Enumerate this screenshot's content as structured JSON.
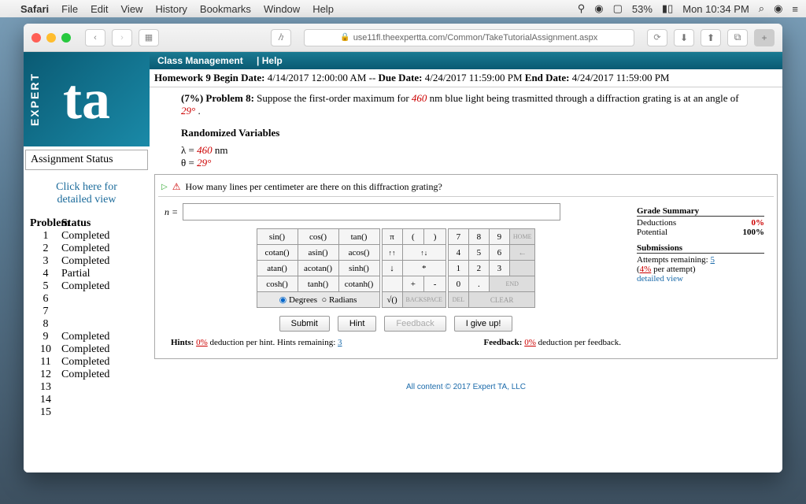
{
  "menubar": {
    "app": "Safari",
    "items": [
      "File",
      "Edit",
      "View",
      "History",
      "Bookmarks",
      "Window",
      "Help"
    ],
    "battery": "53%",
    "clock": "Mon 10:34 PM"
  },
  "browser": {
    "url": "use11fl.theexpertta.com/Common/TakeTutorialAssignment.aspx"
  },
  "logo": {
    "side": "EXPERT",
    "main": "ta"
  },
  "sidebar": {
    "assign_title": "Assignment Status",
    "click1": "Click here for",
    "click2": "detailed view",
    "head_problem": "Problem",
    "head_status": "Status",
    "rows": [
      {
        "n": "1",
        "s": "Completed"
      },
      {
        "n": "2",
        "s": "Completed"
      },
      {
        "n": "3",
        "s": "Completed"
      },
      {
        "n": "4",
        "s": "Partial"
      },
      {
        "n": "5",
        "s": "Completed"
      },
      {
        "n": "6",
        "s": ""
      },
      {
        "n": "7",
        "s": ""
      },
      {
        "n": "8",
        "s": ""
      },
      {
        "n": "9",
        "s": "Completed"
      },
      {
        "n": "10",
        "s": "Completed"
      },
      {
        "n": "11",
        "s": "Completed"
      },
      {
        "n": "12",
        "s": "Completed"
      },
      {
        "n": "13",
        "s": ""
      },
      {
        "n": "14",
        "s": ""
      },
      {
        "n": "15",
        "s": ""
      }
    ]
  },
  "mainbar": {
    "a": "Class Management",
    "b": "Help"
  },
  "dates": {
    "label1": "Homework 9 Begin Date:",
    "v1": " 4/14/2017 12:00:00 AM -- ",
    "label2": "Due Date:",
    "v2": " 4/24/2017 11:59:00 PM ",
    "label3": "End Date:",
    "v3": " 4/24/2017 11:59:00 PM"
  },
  "problem": {
    "pct": "(7%) Problem 8: ",
    "text1": "Suppose the first-order maximum for ",
    "lambda": "460",
    "text2": " nm blue light being trasmitted through a diffraction grating is at an angle of ",
    "theta": "29°",
    "text3": ".",
    "rand": "Randomized Variables",
    "rv1a": "λ = ",
    "rv1b": "460",
    "rv1c": " nm",
    "rv2a": "θ = ",
    "rv2b": "29°"
  },
  "question": "How many lines per centimeter are there on this diffraction grating?",
  "neq": "n = ",
  "calc": {
    "r1": [
      "sin()",
      "cos()",
      "tan()",
      "π",
      "(",
      ")",
      "7",
      "8",
      "9",
      "HOME"
    ],
    "r2": [
      "cotan()",
      "asin()",
      "acos()",
      "↑↑",
      "↑↓",
      "4",
      "5",
      "6",
      "←"
    ],
    "r3": [
      "atan()",
      "acotan()",
      "sinh()",
      "↓",
      "*",
      "1",
      "2",
      "3",
      ""
    ],
    "r4": [
      "cosh()",
      "tanh()",
      "cotanh()",
      "",
      "+",
      "-",
      "0",
      ".",
      "END"
    ],
    "deg": "Degrees",
    "rad": "Radians",
    "bottom": [
      "√()",
      "BACKSPACE",
      "DEL",
      "CLEAR"
    ]
  },
  "buttons": {
    "submit": "Submit",
    "hint": "Hint",
    "feedback": "Feedback",
    "giveup": "I give up!"
  },
  "hints": {
    "l1": "Hints: ",
    "l2": "0%",
    "l3": " deduction per hint. Hints remaining: ",
    "l4": "3",
    "f1": "Feedback: ",
    "f2": "0%",
    "f3": " deduction per feedback."
  },
  "grade": {
    "title": "Grade Summary",
    "d": "Deductions",
    "dv": "0%",
    "p": "Potential",
    "pv": "100%",
    "sub": "Submissions",
    "att1": "Attempts remaining: ",
    "att2": "5",
    "per1": "(",
    "per2": "4%",
    "per3": " per attempt)",
    "dv2": "detailed view"
  },
  "copyright": "All content © 2017 Expert TA, LLC"
}
